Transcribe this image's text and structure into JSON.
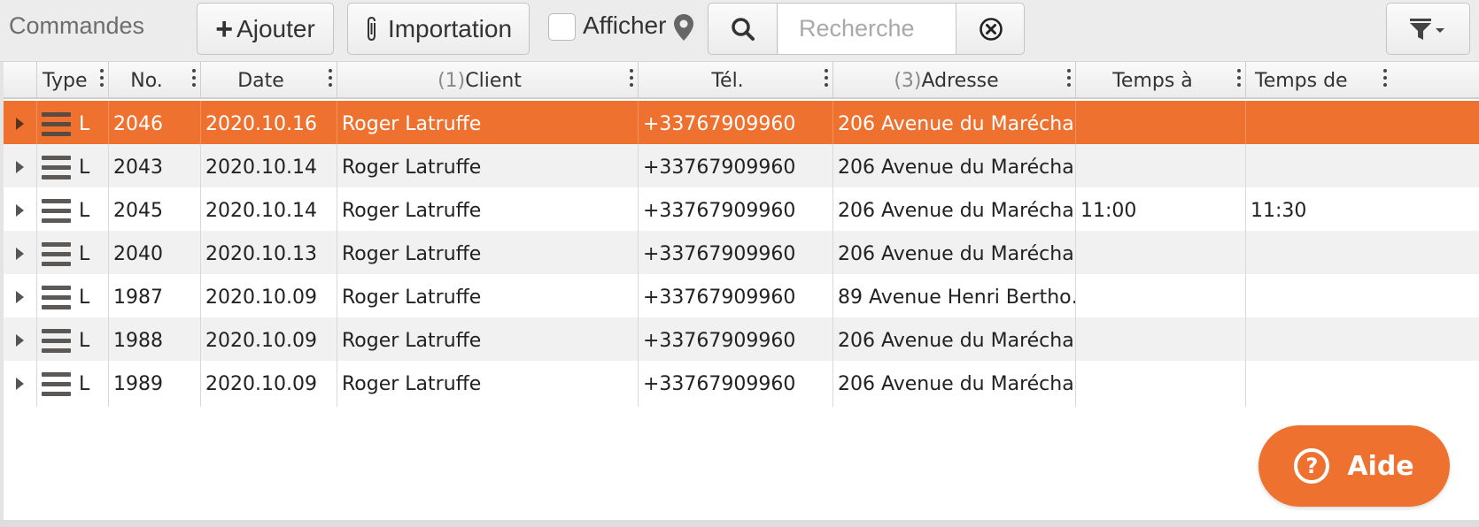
{
  "toolbar": {
    "title": "Commandes",
    "add_label": "Ajouter",
    "import_label": "Importation",
    "show_label": "Afficher",
    "show_checked": false,
    "search_placeholder": "Recherche",
    "search_value": ""
  },
  "columns": [
    {
      "label": "Type",
      "num": ""
    },
    {
      "label": "No.",
      "num": ""
    },
    {
      "label": "Date",
      "num": ""
    },
    {
      "label": "Client",
      "num": "(1)"
    },
    {
      "label": "Tél.",
      "num": ""
    },
    {
      "label": "Adresse",
      "num": "(3)"
    },
    {
      "label": "Temps à",
      "num": ""
    },
    {
      "label": "Temps de",
      "num": ""
    }
  ],
  "rows": [
    {
      "type": "L",
      "no": "2046",
      "date": "2020.10.16",
      "client": "Roger Latruffe",
      "tel": "+33767909960",
      "adresse": "206 Avenue du Marécha…",
      "temps_a": "",
      "temps_de": "",
      "selected": true
    },
    {
      "type": "L",
      "no": "2043",
      "date": "2020.10.14",
      "client": "Roger Latruffe",
      "tel": "+33767909960",
      "adresse": "206 Avenue du Marécha…",
      "temps_a": "",
      "temps_de": "",
      "selected": false
    },
    {
      "type": "L",
      "no": "2045",
      "date": "2020.10.14",
      "client": "Roger Latruffe",
      "tel": "+33767909960",
      "adresse": "206 Avenue du Marécha…",
      "temps_a": "11:00",
      "temps_de": "11:30",
      "selected": false
    },
    {
      "type": "L",
      "no": "2040",
      "date": "2020.10.13",
      "client": "Roger Latruffe",
      "tel": "+33767909960",
      "adresse": "206 Avenue du Marécha…",
      "temps_a": "",
      "temps_de": "",
      "selected": false
    },
    {
      "type": "L",
      "no": "1987",
      "date": "2020.10.09",
      "client": "Roger Latruffe",
      "tel": "+33767909960",
      "adresse": "89 Avenue Henri Bertho…",
      "temps_a": "",
      "temps_de": "",
      "selected": false
    },
    {
      "type": "L",
      "no": "1988",
      "date": "2020.10.09",
      "client": "Roger Latruffe",
      "tel": "+33767909960",
      "adresse": "206 Avenue du Marécha…",
      "temps_a": "",
      "temps_de": "",
      "selected": false
    },
    {
      "type": "L",
      "no": "1989",
      "date": "2020.10.09",
      "client": "Roger Latruffe",
      "tel": "+33767909960",
      "adresse": "206 Avenue du Marécha…",
      "temps_a": "",
      "temps_de": "",
      "selected": false
    }
  ],
  "help": {
    "label": "Aide",
    "icon_glyph": "?"
  },
  "icons": {
    "add": "plus-icon",
    "import": "paperclip-icon",
    "show_on_map": "map-pin-icon",
    "search": "search-icon",
    "clear": "clear-circle-icon",
    "filter": "filter-icon",
    "row_menu": "hamburger-menu-icon",
    "expand": "expand-triangle-icon",
    "column_menu": "vertical-dots-icon",
    "help": "question-circle-icon"
  },
  "colors": {
    "accent": "#ee7130",
    "selected_row": "#ee7130",
    "alt_row": "#f1f1f1",
    "toolbar_bg": "#ececec"
  }
}
